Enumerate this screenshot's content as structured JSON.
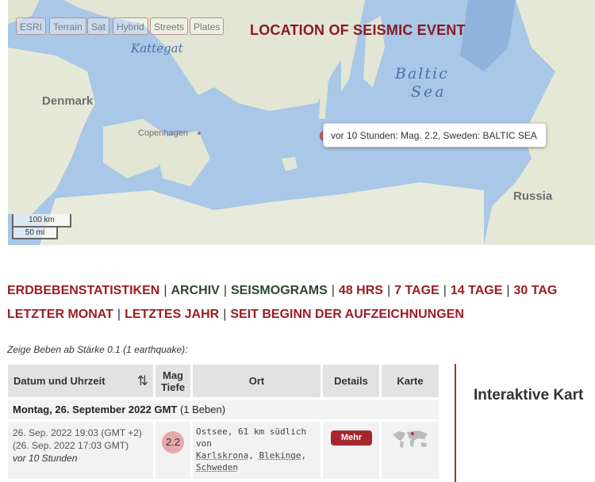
{
  "map": {
    "title": "LOCATION OF SEISMIC EVENT",
    "layers": [
      "ESRI",
      "Terrain",
      "Sat",
      "Hybrid",
      "Streets",
      "Plates"
    ],
    "labels": {
      "kattegat": "Kattegat",
      "denmark": "Denmark",
      "copenhagen": "Copenhagen",
      "baltic1": "Baltic",
      "baltic2": "Sea",
      "russia": "Russia"
    },
    "popup": "vor 10 Stunden: Mag. 2.2, Sweden: BALTIC SEA",
    "scale": {
      "km": "100 km",
      "mi": "50 mi"
    }
  },
  "nav": {
    "line1": [
      "ERDBEBENSTATISTIKEN",
      "ARCHIV",
      "SEISMOGRAMS",
      "48 HRS",
      "7 TAGE",
      "14 TAGE",
      "30 TAG"
    ],
    "line2": [
      "LETZTER MONAT",
      "LETZTES JAHR",
      "SEIT BEGINN DER AUFZEICHNUNGEN"
    ]
  },
  "filter_text": "Zeige Beben ab Stärke 0.1 (1 earthquake):",
  "table": {
    "headers": {
      "datetime": "Datum und Uhrzeit",
      "mag": "Mag",
      "depth": "Tiefe",
      "ort": "Ort",
      "details": "Details",
      "karte": "Karte"
    },
    "date_group": {
      "date": "Montag, 26. September 2022 GMT",
      "count": "(1 Beben)"
    },
    "rows": [
      {
        "time_local": "26. Sep. 2022 19:03 (GMT +2)",
        "time_gmt": "(26. Sep. 2022 17:03 GMT)",
        "ago": "vor 10 Stunden",
        "mag": "2.2",
        "ort_prefix": "Ostsee, 61 km südlich von",
        "ort_city": "Karlskrona",
        "ort_region": "Blekinge",
        "ort_country": "Schweden",
        "details_button": "Mehr"
      }
    ]
  },
  "interactive_heading": "Interaktive Kart",
  "colors": {
    "accent": "#9d1c22",
    "nav_dark": "#2a4a2a",
    "water": "#a9c7e6",
    "land": "#e8eadc"
  }
}
